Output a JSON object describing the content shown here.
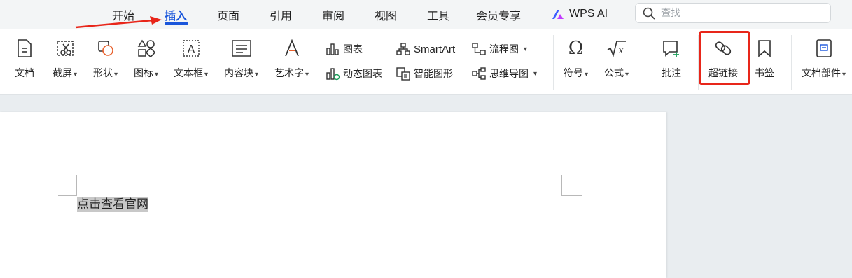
{
  "menu": {
    "tabs": [
      "开始",
      "插入",
      "页面",
      "引用",
      "审阅",
      "视图",
      "工具",
      "会员专享"
    ],
    "active_tab": "插入",
    "ai_label": "WPS AI"
  },
  "search": {
    "placeholder": "查找"
  },
  "ribbon": {
    "wendang": "文档",
    "jieping": "截屏",
    "xingzhuang": "形状",
    "tubiao": "图标",
    "wenbenkuang": "文本框",
    "neirongkuai": "内容块",
    "yishuzi": "艺术字",
    "chart": "图表",
    "dynamic_chart": "动态图表",
    "smartart": "SmartArt",
    "smart_graphic": "智能图形",
    "flowchart": "流程图",
    "mindmap": "思维导图",
    "symbol": "符号",
    "formula": "公式",
    "comment": "批注",
    "hyperlink": "超链接",
    "bookmark": "书签",
    "doc_parts": "文档部件"
  },
  "document": {
    "text": "点击查看官网"
  },
  "colors": {
    "accent": "#1a56db",
    "annotation_red": "#e8261a"
  }
}
